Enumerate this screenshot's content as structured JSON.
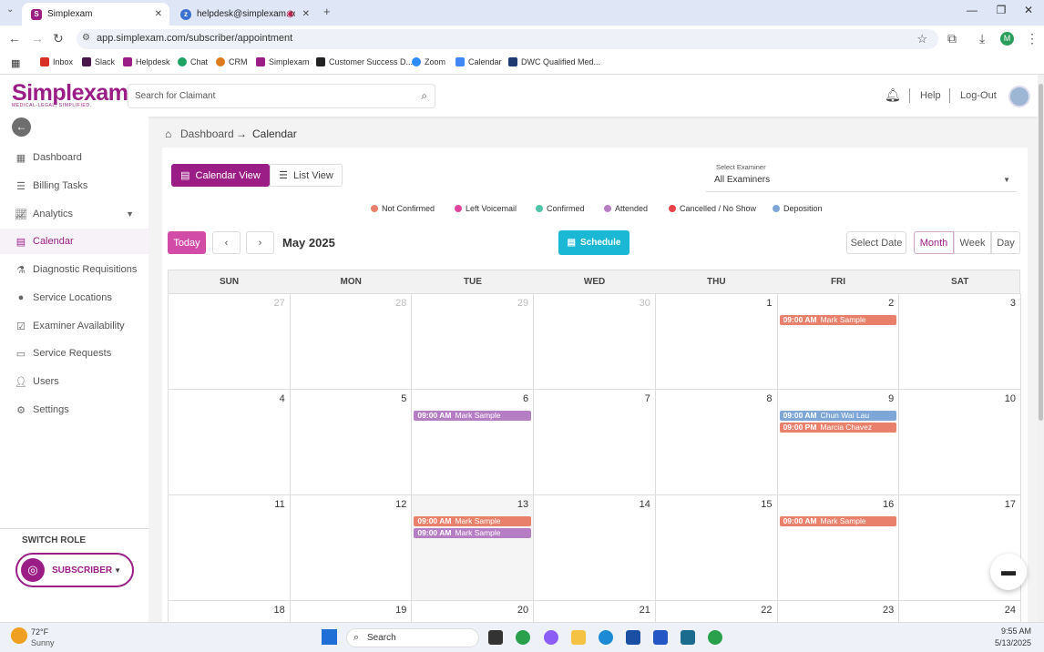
{
  "browser": {
    "tabs": [
      {
        "title": "Simplexam",
        "active": true
      },
      {
        "title": "helpdesk@simplexam.com",
        "active": false
      }
    ],
    "url": "app.simplexam.com/subscriber/appointment",
    "bookmarks": [
      "Inbox",
      "Slack",
      "Helpdesk",
      "Chat",
      "CRM",
      "Simplexam",
      "Customer Success D...",
      "Zoom",
      "Calendar",
      "DWC Qualified Med..."
    ],
    "profile_initial": "M"
  },
  "app": {
    "logo_name": "Simplexam",
    "logo_tagline": "MEDICAL-LEGAL, SIMPLIFIED.",
    "search_placeholder": "Search for Claimant",
    "help_label": "Help",
    "logout_label": "Log-Out"
  },
  "sidebar": {
    "items": [
      {
        "label": "Dashboard",
        "icon": "grid-icon"
      },
      {
        "label": "Billing Tasks",
        "icon": "list-icon"
      },
      {
        "label": "Analytics",
        "icon": "chart-icon"
      },
      {
        "label": "Calendar",
        "icon": "calendar-icon"
      },
      {
        "label": "Diagnostic Requisitions",
        "icon": "flask-icon"
      },
      {
        "label": "Service Locations",
        "icon": "location-icon"
      },
      {
        "label": "Examiner Availability",
        "icon": "check-calendar-icon"
      },
      {
        "label": "Service Requests",
        "icon": "document-icon"
      },
      {
        "label": "Users",
        "icon": "user-icon"
      },
      {
        "label": "Settings",
        "icon": "gear-icon"
      }
    ],
    "switch_role_label": "SWITCH ROLE",
    "role": "SUBSCRIBER"
  },
  "breadcrumb": {
    "home": "Dashboard",
    "current": "Calendar"
  },
  "calendar": {
    "view_tabs": [
      "Calendar View",
      "List View"
    ],
    "examiner_label": "Select Examiner",
    "examiner_value": "All Examiners",
    "legend": [
      {
        "label": "Not Confirmed",
        "color": "#e8806b"
      },
      {
        "label": "Left Voicemail",
        "color": "#e0449c"
      },
      {
        "label": "Confirmed",
        "color": "#4fc4a8"
      },
      {
        "label": "Attended",
        "color": "#b57ec4"
      },
      {
        "label": "Cancelled / No Show",
        "color": "#e8424a"
      },
      {
        "label": "Deposition",
        "color": "#7ea7d8"
      }
    ],
    "today_label": "Today",
    "month_label": "May 2025",
    "schedule_label": "Schedule",
    "select_date_label": "Select Date",
    "range_options": [
      "Month",
      "Week",
      "Day"
    ],
    "selected_range": "Month",
    "weekdays": [
      "SUN",
      "MON",
      "TUE",
      "WED",
      "THU",
      "FRI",
      "SAT"
    ],
    "weeks": [
      [
        {
          "d": "27",
          "m": true
        },
        {
          "d": "28",
          "m": true
        },
        {
          "d": "29",
          "m": true
        },
        {
          "d": "30",
          "m": true
        },
        {
          "d": "1"
        },
        {
          "d": "2",
          "events": [
            {
              "time": "09:00 AM",
              "name": "Mark Sample",
              "color": "#e8806b"
            }
          ]
        },
        {
          "d": "3"
        }
      ],
      [
        {
          "d": "4"
        },
        {
          "d": "5"
        },
        {
          "d": "6",
          "events": [
            {
              "time": "09:00 AM",
              "name": "Mark Sample",
              "color": "#b57ec4"
            }
          ]
        },
        {
          "d": "7"
        },
        {
          "d": "8"
        },
        {
          "d": "9",
          "events": [
            {
              "time": "09:00 AM",
              "name": "Chun Wai Lau",
              "color": "#7ea7d8"
            },
            {
              "time": "09:00 PM",
              "name": "Marcia Chavez",
              "color": "#e8806b"
            }
          ]
        },
        {
          "d": "10"
        }
      ],
      [
        {
          "d": "11"
        },
        {
          "d": "12"
        },
        {
          "d": "13",
          "shaded": true,
          "events": [
            {
              "time": "09:00 AM",
              "name": "Mark Sample",
              "color": "#e8806b"
            },
            {
              "time": "09:00 AM",
              "name": "Mark Sample",
              "color": "#b57ec4"
            }
          ]
        },
        {
          "d": "14"
        },
        {
          "d": "15"
        },
        {
          "d": "16",
          "events": [
            {
              "time": "09:00 AM",
              "name": "Mark Sample",
              "color": "#e8806b"
            }
          ]
        },
        {
          "d": "17"
        }
      ],
      [
        {
          "d": "18"
        },
        {
          "d": "19"
        },
        {
          "d": "20"
        },
        {
          "d": "21"
        },
        {
          "d": "22"
        },
        {
          "d": "23"
        },
        {
          "d": "24"
        }
      ]
    ]
  },
  "taskbar": {
    "weather_temp": "72°F",
    "weather_desc": "Sunny",
    "search_label": "Search",
    "time": "9:55 AM",
    "date": "5/13/2025"
  },
  "colors": {
    "brand": "#9b1e86",
    "accent": "#1bb8d6"
  }
}
